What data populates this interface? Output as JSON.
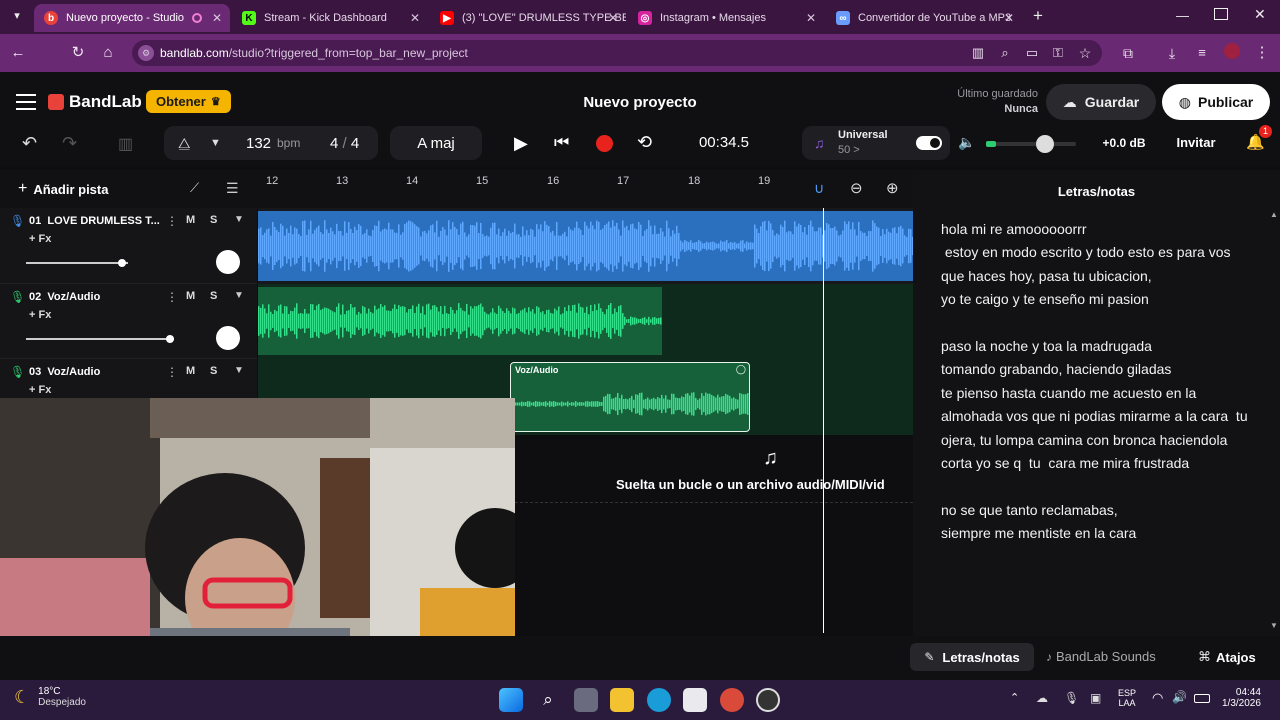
{
  "browser": {
    "tabs": [
      {
        "title": "Nuevo proyecto - Studio",
        "icon": "bandlab-icon",
        "color": "#e8423a"
      },
      {
        "title": "Stream - Kick Dashboard",
        "icon": "kick-icon",
        "color": "#53fc18"
      },
      {
        "title": "(3) \"LOVE\" DRUMLESS TYPE BE",
        "icon": "youtube-icon",
        "color": "#ff0000"
      },
      {
        "title": "Instagram • Mensajes",
        "icon": "instagram-icon",
        "color": "#d6249f"
      },
      {
        "title": "Convertidor de YouTube a MP3",
        "icon": "link-icon",
        "color": "#6a9cff"
      }
    ],
    "url_domain": "bandlab.com",
    "url_path": "/studio?triggered_from=top_bar_new_project"
  },
  "app": {
    "brand": "BandLab",
    "obtener_label": "Obtener",
    "project_title": "Nuevo proyecto",
    "last_saved_label": "Último guardado",
    "last_saved_value": "Nunca",
    "save_label": "Guardar",
    "publish_label": "Publicar",
    "accent": "#f5b400"
  },
  "toolbar": {
    "bpm_value": "132",
    "bpm_unit": "bpm",
    "time_sig_top": "4",
    "time_sig_sep": "/",
    "time_sig_bottom": "4",
    "key": "A maj",
    "time": "00:34.5",
    "universal_label": "Universal",
    "universal_value": "50 >",
    "volume_db": "+0.0 dB",
    "invite_label": "Invitar",
    "notification_count": "1"
  },
  "tracks_panel": {
    "add_track_label": "Añadir pista",
    "ruler": [
      "12",
      "13",
      "14",
      "15",
      "16",
      "17",
      "18",
      "19"
    ],
    "tracks": [
      {
        "name": "01  LOVE DRUMLESS T...",
        "fx": "+ Fx",
        "m": "M",
        "s": "S",
        "color": "#3d8fe8"
      },
      {
        "name": "02  Voz/Audio",
        "fx": "+ Fx",
        "m": "M",
        "s": "S",
        "color": "#2ecc71"
      },
      {
        "name": "03  Voz/Audio",
        "fx": "+ Fx",
        "m": "M",
        "s": "S",
        "color": "#2ecc71"
      }
    ],
    "clip_label": "Voz/Audio",
    "drop_hint": "Suelta un bucle o un archivo audio/MIDI/vid"
  },
  "lyrics": {
    "title": "Letras/notas",
    "body": "hola mi re amoooooorrr\n estoy en modo escrito y todo esto es para vos\nque haces hoy, pasa tu ubicacion,\nyo te caigo y te enseño mi pasion\n\npaso la noche y toa la madrugada\ntomando grabando, haciendo giladas\nte pienso hasta cuando me acuesto en la almohada vos que ni podias mirarme a la cara  tu ojera, tu lompa camina con bronca haciendola corta yo se q  tu  cara me mira frustrada\n\nno se que tanto reclamabas,\nsiempre me mentiste en la cara"
  },
  "bottom": {
    "tab_lyrics": "Letras/notas",
    "tab_sounds": "BandLab Sounds",
    "shortcuts": "Atajos"
  },
  "taskbar": {
    "weather_temp": "18°C",
    "weather_desc": "Despejado",
    "lang_1": "ESP",
    "lang_2": "LAA",
    "clock_time": "04:44",
    "clock_date": "1/3/2026"
  }
}
